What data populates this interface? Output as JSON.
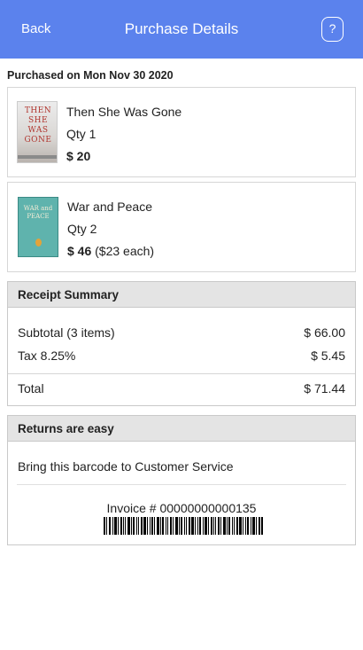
{
  "header": {
    "back_label": "Back",
    "title": "Purchase Details",
    "help_glyph": "?",
    "background_color": "#5b82ed"
  },
  "purchase": {
    "date_label": "Purchased on Mon Nov 30 2020"
  },
  "items": [
    {
      "title": "Then She Was Gone",
      "qty": "Qty 1",
      "price": "$ 20",
      "each": "",
      "cover_text": "THEN SHE WAS GONE"
    },
    {
      "title": "War and Peace",
      "qty": "Qty 2",
      "price": "$ 46",
      "each": "($23 each)",
      "cover_text": "WAR and PEACE"
    }
  ],
  "receipt": {
    "heading": "Receipt Summary",
    "subtotal_label": "Subtotal (3 items)",
    "subtotal_value": "$ 66.00",
    "tax_label": "Tax 8.25%",
    "tax_value": "$ 5.45",
    "total_label": "Total",
    "total_value": "$ 71.44"
  },
  "returns": {
    "heading": "Returns are easy",
    "instruction": "Bring this barcode to Customer Service",
    "invoice_label": "Invoice # 00000000000135"
  }
}
